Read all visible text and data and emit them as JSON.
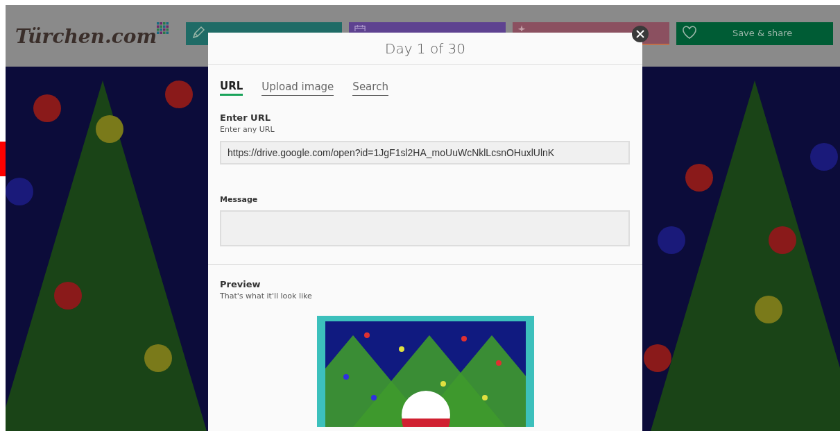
{
  "header": {
    "logo": "Türchen.com",
    "buttons": [
      {
        "kind": "theme",
        "color": "#1f6b66"
      },
      {
        "kind": "dates",
        "color": "#5e4290"
      },
      {
        "kind": "autofill",
        "color": "#8b5060"
      },
      {
        "kind": "save",
        "label": "Save & share",
        "color": "#005c35"
      }
    ]
  },
  "dialog": {
    "title": "Day 1 of 30",
    "tabs": [
      {
        "label": "URL",
        "selected": true
      },
      {
        "label": "Upload image",
        "selected": false
      },
      {
        "label": "Search",
        "selected": false
      }
    ],
    "url": {
      "label": "Enter URL",
      "hint": "Enter any URL",
      "value": "https://drive.google.com/open?id=1JgF1sl2HA_moUuWcNklLcsnOHuxlUlnK"
    },
    "message": {
      "label": "Message"
    },
    "preview": {
      "title": "Preview",
      "hint": "That's what it'll look like"
    }
  }
}
